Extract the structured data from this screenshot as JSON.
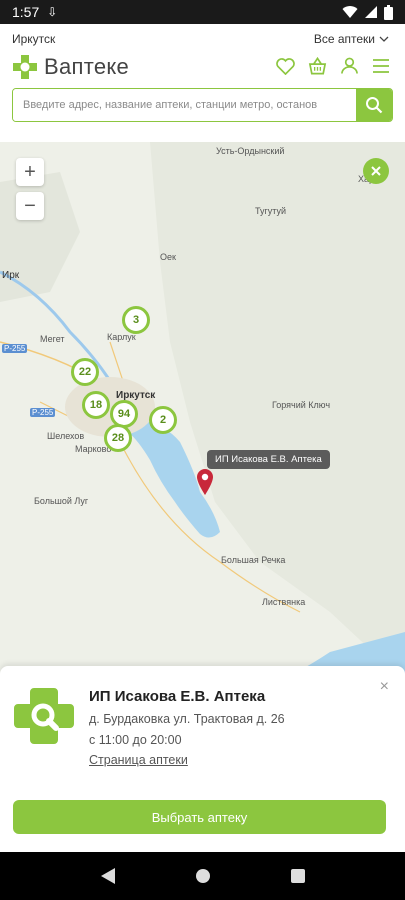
{
  "status_bar": {
    "time": "1:57"
  },
  "header": {
    "city": "Иркутск",
    "all_pharmacies": "Все аптеки",
    "logo_text": "Вaптеке",
    "search": {
      "placeholder": "Введите адрес, название аптеки, станции метро, останов"
    }
  },
  "map": {
    "zoom_in": "+",
    "zoom_out": "−",
    "clusters": [
      {
        "label": "3"
      },
      {
        "label": "22"
      },
      {
        "label": "18"
      },
      {
        "label": "94"
      },
      {
        "label": "2"
      },
      {
        "label": "28"
      }
    ],
    "places": [
      "Усть-Ордынский",
      "Харат",
      "Тугутуй",
      "Оек",
      "Карлук",
      "Мегет",
      "Иркутск",
      "Шелехов",
      "Марково",
      "Горячий Ключ",
      "Большой Луг",
      "Большая Речка",
      "Листвянка",
      "Р-255",
      "Р-255",
      "Ирк"
    ],
    "tooltip": "ИП Исакова Е.В. Аптека"
  },
  "card": {
    "title": "ИП Исакова Е.В. Аптека",
    "address": "д. Бурдаковка ул. Трактовая д. 26",
    "hours": "с 11:00 до 20:00",
    "link": "Страница аптеки",
    "button": "Выбрать аптеку",
    "close": "×"
  },
  "colors": {
    "accent": "#8cc63f",
    "water": "#a9d4ee"
  }
}
